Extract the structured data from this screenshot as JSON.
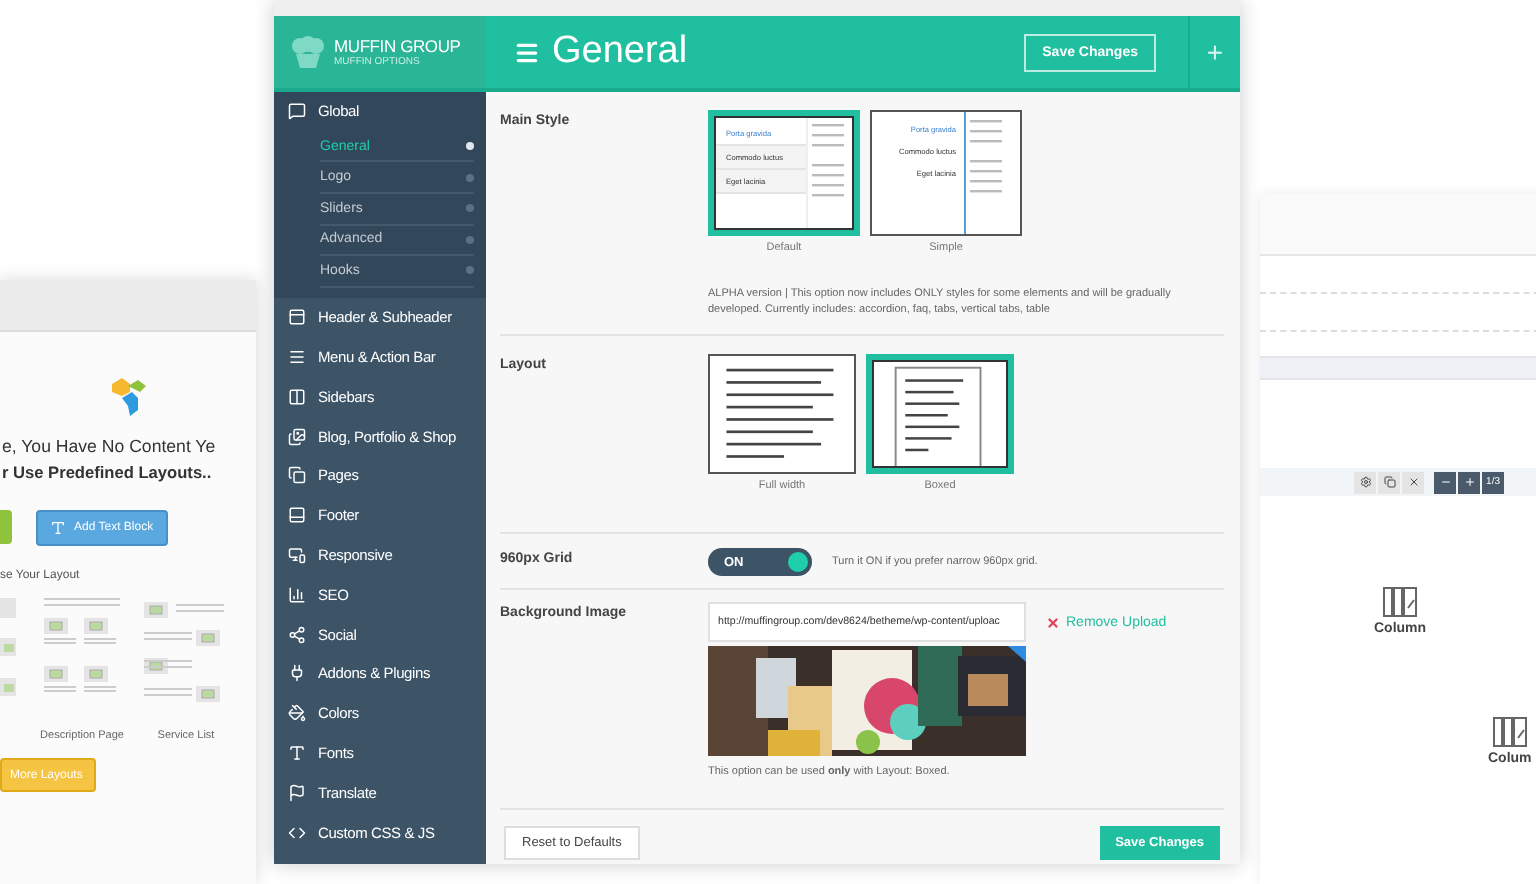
{
  "left_card": {
    "headline": [
      "e, You Have No Content Ye",
      "r Use Predefined Layouts.."
    ],
    "add_button": "Add Text Block",
    "layouts_heading": "se Your Layout",
    "layouts": [
      {
        "name": "Description Page"
      },
      {
        "name": "Service List"
      }
    ],
    "more_button": "More Layouts"
  },
  "right_card": {
    "counter": "1/3",
    "elements": [
      {
        "label": "Column"
      },
      {
        "label": "Colum"
      }
    ]
  },
  "panel": {
    "brand": {
      "name": "MUFFIN GROUP",
      "subtitle": "MUFFIN OPTIONS"
    },
    "title": "General",
    "header_button": "Save Changes",
    "header_plus": "+",
    "sidebar": [
      {
        "label": "Global",
        "expanded": true,
        "children": [
          {
            "label": "General",
            "selected": true
          },
          {
            "label": "Logo",
            "selected": false
          },
          {
            "label": "Sliders",
            "selected": false
          },
          {
            "label": "Advanced",
            "selected": false
          },
          {
            "label": "Hooks",
            "selected": false
          }
        ]
      },
      {
        "label": "Header & Subheader",
        "expanded": false
      },
      {
        "label": "Menu & Action Bar",
        "expanded": false
      },
      {
        "label": "Sidebars",
        "expanded": false
      },
      {
        "label": "Blog, Portfolio & Shop",
        "expanded": false
      },
      {
        "label": "Pages",
        "expanded": false
      },
      {
        "label": "Footer",
        "expanded": false
      },
      {
        "label": "Responsive",
        "expanded": false
      },
      {
        "label": "SEO",
        "expanded": false
      },
      {
        "label": "Social",
        "expanded": false
      },
      {
        "label": "Addons & Plugins",
        "expanded": false
      },
      {
        "label": "Colors",
        "expanded": false
      },
      {
        "label": "Fonts",
        "expanded": false
      },
      {
        "label": "Translate",
        "expanded": false
      },
      {
        "label": "Custom CSS & JS",
        "expanded": false
      }
    ],
    "options": [
      {
        "kind": "image_select",
        "label": "Main Style",
        "choices": [
          {
            "caption": "Default",
            "kind": "tabs",
            "tabs": [
              "Porta gravida",
              "Commodo luctus",
              "Eget lacinia"
            ],
            "selected": true
          },
          {
            "caption": "Simple",
            "kind": "simple",
            "tabs": [
              "Porta gravida",
              "Commodo luctus",
              "Eget lacinia"
            ],
            "selected": false
          }
        ],
        "note": "ALPHA version | This option now includes ONLY styles for some elements and will be gradually developed. Currently includes: accordion, faq, tabs, vertical tabs, table"
      },
      {
        "kind": "image_select",
        "label": "Layout",
        "choices": [
          {
            "caption": "Full width",
            "kind": "full",
            "selected": false
          },
          {
            "caption": "Boxed",
            "kind": "boxed",
            "selected": true
          }
        ]
      },
      {
        "kind": "toggle",
        "label": "960px Grid",
        "on": true,
        "state_label": "ON",
        "description": "Turn it ON if you prefer narrow 960px grid."
      },
      {
        "kind": "upload",
        "label": "Background Image",
        "value": "http://muffingroup.com/dev8624/betheme/wp-content/uploac",
        "remove": "Remove Upload",
        "note": "This option can be used **only** with Layout: Boxed."
      }
    ],
    "footer": {
      "reset": "Reset to Defaults",
      "save": "Save Changes"
    }
  }
}
